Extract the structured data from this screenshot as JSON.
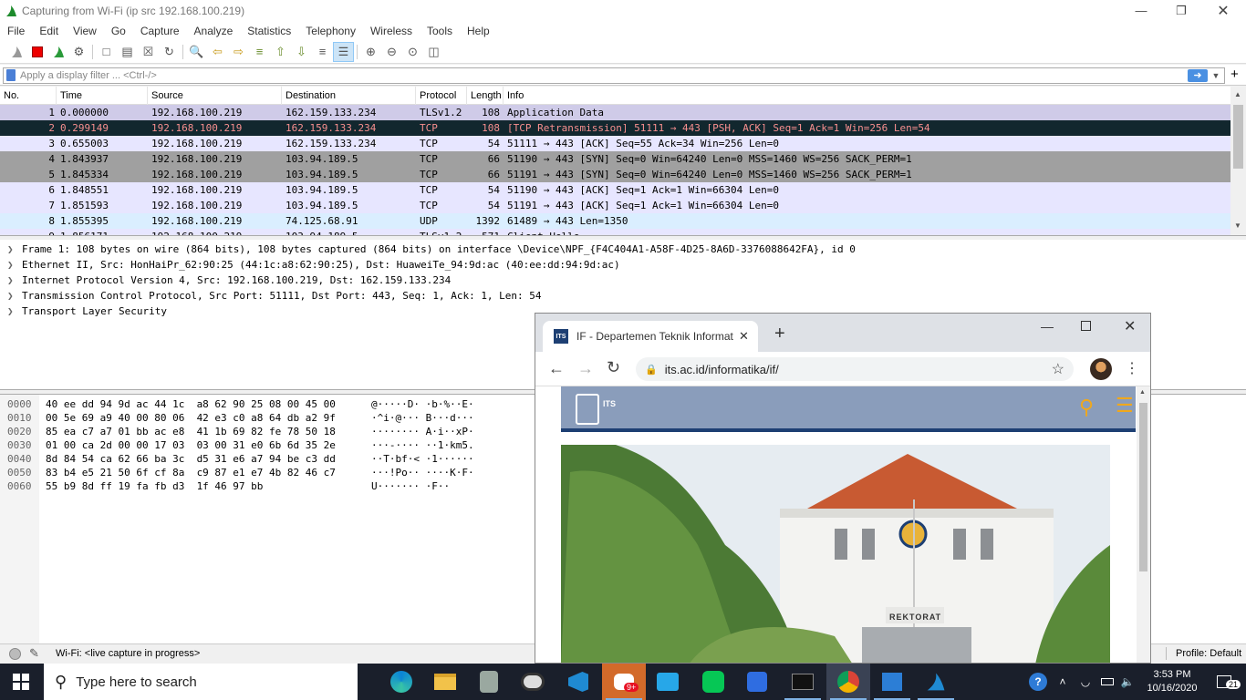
{
  "window": {
    "title": "Capturing from Wi-Fi (ip src 192.168.100.219)",
    "controls": [
      "minimize-icon",
      "restore-icon",
      "close-icon"
    ]
  },
  "menu": [
    "File",
    "Edit",
    "View",
    "Go",
    "Capture",
    "Analyze",
    "Statistics",
    "Telephony",
    "Wireless",
    "Tools",
    "Help"
  ],
  "filter": {
    "placeholder": "Apply a display filter ... <Ctrl-/>",
    "apply_icon": "arrow-right-icon",
    "add_label": "+"
  },
  "packet_list": {
    "columns": [
      "No.",
      "Time",
      "Source",
      "Destination",
      "Protocol",
      "Length",
      "Info"
    ],
    "rows": [
      {
        "no": "1",
        "time": "0.000000",
        "src": "192.168.100.219",
        "dst": "162.159.133.234",
        "proto": "TLSv1.2",
        "len": "108",
        "info": "Application Data",
        "bg": "#cfcbe8",
        "fg": "#000000"
      },
      {
        "no": "2",
        "time": "0.299149",
        "src": "192.168.100.219",
        "dst": "162.159.133.234",
        "proto": "TCP",
        "len": "108",
        "info": "[TCP Retransmission] 51111 → 443 [PSH, ACK] Seq=1 Ack=1 Win=256 Len=54",
        "bg": "#12272e",
        "fg": "#f78f8f"
      },
      {
        "no": "3",
        "time": "0.655003",
        "src": "192.168.100.219",
        "dst": "162.159.133.234",
        "proto": "TCP",
        "len": "54",
        "info": "51111 → 443 [ACK] Seq=55 Ack=34 Win=256 Len=0",
        "bg": "#e7e6ff",
        "fg": "#000000"
      },
      {
        "no": "4",
        "time": "1.843937",
        "src": "192.168.100.219",
        "dst": "103.94.189.5",
        "proto": "TCP",
        "len": "66",
        "info": "51190 → 443 [SYN] Seq=0 Win=64240 Len=0 MSS=1460 WS=256 SACK_PERM=1",
        "bg": "#a0a0a0",
        "fg": "#000000"
      },
      {
        "no": "5",
        "time": "1.845334",
        "src": "192.168.100.219",
        "dst": "103.94.189.5",
        "proto": "TCP",
        "len": "66",
        "info": "51191 → 443 [SYN] Seq=0 Win=64240 Len=0 MSS=1460 WS=256 SACK_PERM=1",
        "bg": "#a0a0a0",
        "fg": "#000000"
      },
      {
        "no": "6",
        "time": "1.848551",
        "src": "192.168.100.219",
        "dst": "103.94.189.5",
        "proto": "TCP",
        "len": "54",
        "info": "51190 → 443 [ACK] Seq=1 Ack=1 Win=66304 Len=0",
        "bg": "#e7e6ff",
        "fg": "#000000"
      },
      {
        "no": "7",
        "time": "1.851593",
        "src": "192.168.100.219",
        "dst": "103.94.189.5",
        "proto": "TCP",
        "len": "54",
        "info": "51191 → 443 [ACK] Seq=1 Ack=1 Win=66304 Len=0",
        "bg": "#e7e6ff",
        "fg": "#000000"
      },
      {
        "no": "8",
        "time": "1.855395",
        "src": "192.168.100.219",
        "dst": "74.125.68.91",
        "proto": "UDP",
        "len": "1392",
        "info": "61489 → 443 Len=1350",
        "bg": "#daeeff",
        "fg": "#000000"
      },
      {
        "no": "9",
        "time": "1.856171",
        "src": "192.168.100.219",
        "dst": "103.94.189.5",
        "proto": "TLSv1.2",
        "len": "571",
        "info": "Client Hello",
        "bg": "#e7e6ff",
        "fg": "#000000"
      }
    ]
  },
  "details": [
    "Frame 1: 108 bytes on wire (864 bits), 108 bytes captured (864 bits) on interface \\Device\\NPF_{F4C404A1-A58F-4D25-8A6D-3376088642FA}, id 0",
    "Ethernet II, Src: HonHaiPr_62:90:25 (44:1c:a8:62:90:25), Dst: HuaweiTe_94:9d:ac (40:ee:dd:94:9d:ac)",
    "Internet Protocol Version 4, Src: 192.168.100.219, Dst: 162.159.133.234",
    "Transmission Control Protocol, Src Port: 51111, Dst Port: 443, Seq: 1, Ack: 1, Len: 54",
    "Transport Layer Security"
  ],
  "hex": [
    {
      "off": "0000",
      "bytes": "40 ee dd 94 9d ac 44 1c  a8 62 90 25 08 00 45 00",
      "ascii": "@·····D· ·b·%··E·"
    },
    {
      "off": "0010",
      "bytes": "00 5e 69 a9 40 00 80 06  42 e3 c0 a8 64 db a2 9f",
      "ascii": "·^i·@··· B···d···"
    },
    {
      "off": "0020",
      "bytes": "85 ea c7 a7 01 bb ac e8  41 1b 69 82 fe 78 50 18",
      "ascii": "········ A·i··xP·"
    },
    {
      "off": "0030",
      "bytes": "01 00 ca 2d 00 00 17 03  03 00 31 e0 6b 6d 35 2e",
      "ascii": "···-···· ··1·km5."
    },
    {
      "off": "0040",
      "bytes": "8d 84 54 ca 62 66 ba 3c  d5 31 e6 a7 94 be c3 dd",
      "ascii": "··T·bf·< ·1······"
    },
    {
      "off": "0050",
      "bytes": "83 b4 e5 21 50 6f cf 8a  c9 87 e1 e7 4b 82 46 c7",
      "ascii": "···!Po·· ····K·F·"
    },
    {
      "off": "0060",
      "bytes": "55 b9 8d ff 19 fa fb d3  1f 46 97 bb",
      "ascii": "U······· ·F··"
    }
  ],
  "status": {
    "text": "Wi-Fi: <live capture in progress>",
    "profile": "Profile: Default"
  },
  "browser": {
    "tab_title": "IF - Departemen Teknik Informatika",
    "url": "its.ac.id/informatika/if/",
    "site_logo_text": "ITS",
    "building_sign": "REKTORAT"
  },
  "taskbar": {
    "search_placeholder": "Type here to search",
    "time": "3:53 PM",
    "date": "10/16/2020",
    "notifications": "21",
    "badge": "9+"
  },
  "colors": {
    "accent": "#0078d7",
    "selected_row": "#12272e",
    "retransmission_text": "#f78f8f",
    "site_header": "#8a9dbb",
    "site_icon": "#f0a81c"
  }
}
